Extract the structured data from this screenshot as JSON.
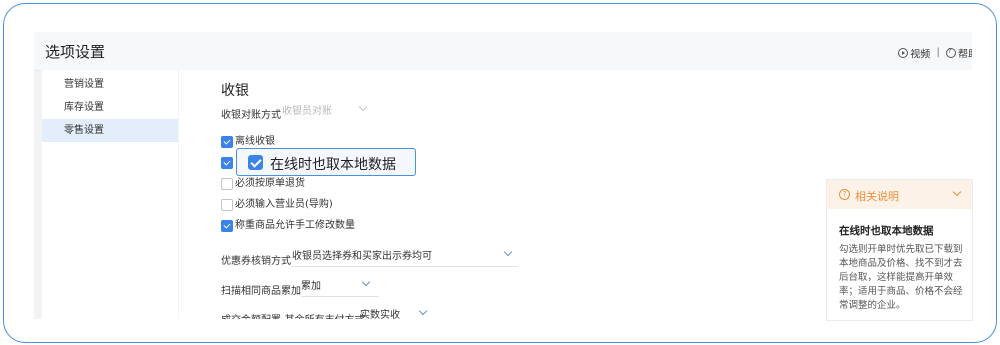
{
  "window": {
    "title": "选项设置",
    "video_label": "视频",
    "separator": "|",
    "help_label": "帮助"
  },
  "sidebar": {
    "items": [
      {
        "label": "营销设置",
        "active": false
      },
      {
        "label": "库存设置",
        "active": false
      },
      {
        "label": "零售设置",
        "active": true
      }
    ]
  },
  "content": {
    "section_title": "收银",
    "reconcile": {
      "label": "收银对账方式",
      "value": "收银员对账"
    },
    "checkboxes": [
      {
        "label": "离线收银",
        "checked": true
      },
      {
        "label": "",
        "checked": true
      },
      {
        "label": "必须按原单退货",
        "checked": false
      },
      {
        "label": "必须输入营业员(导购)",
        "checked": false
      },
      {
        "label": "称重商品允许手工修改数量",
        "checked": true
      }
    ],
    "callout": {
      "label": "在线时也取本地数据",
      "checked": true
    },
    "coupon": {
      "label": "优惠券核销方式",
      "value": "收银员选择券和买家出示券均可"
    },
    "scan": {
      "label": "扫描相同商品累加",
      "value": "累加"
    },
    "payment": {
      "label": "成交金额配置-其余所有支付方式",
      "value": "实数实收"
    }
  },
  "help": {
    "title": "相关说明",
    "body_title": "在线时也取本地数据",
    "body_text": "勾选则开单时优先取已下载到本地商品及价格、找不到才去后台取，这样能提高开单效率；适用于商品、价格不会经常调整的企业。"
  },
  "colors": {
    "accent": "#3b83e6",
    "frame_border": "#4a90e2",
    "help_orange": "#e8913a",
    "sidebar_active": "#e4eefb"
  }
}
